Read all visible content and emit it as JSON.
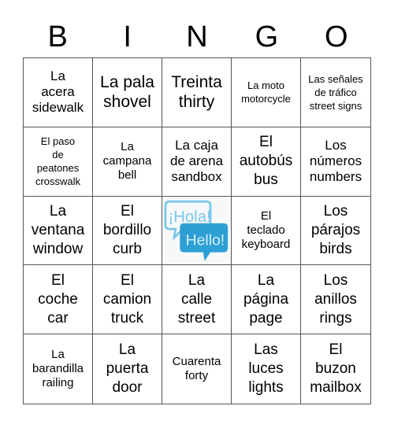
{
  "header": {
    "letters": [
      "B",
      "I",
      "N",
      "G",
      "O"
    ]
  },
  "free_space": {
    "icon": "hola-hello-speech-bubbles-icon",
    "text_es": "¡Hola!",
    "text_en": "Hello!",
    "colors": {
      "light_bubble": "#7cc8ea",
      "dark_bubble": "#2d9fd4"
    }
  },
  "cells": [
    {
      "es": "La\nacera",
      "en": "sidewalk",
      "size": "s-m"
    },
    {
      "es": "La pala",
      "en": "shovel",
      "size": "s-xl"
    },
    {
      "es": "Treinta",
      "en": "thirty",
      "size": "s-xl"
    },
    {
      "es": "La moto",
      "en": "motorcycle",
      "size": "s-xs"
    },
    {
      "es": "Las señales\nde tráfico",
      "en": "street signs",
      "size": "s-xs"
    },
    {
      "es": "El paso\nde\npeatones",
      "en": "crosswalk",
      "size": "s-xs"
    },
    {
      "es": "La\ncampana",
      "en": "bell",
      "size": "s-s"
    },
    {
      "es": "La caja\nde arena",
      "en": "sandbox",
      "size": "s-m"
    },
    {
      "es": "El\nautobús",
      "en": "bus",
      "size": "s-l"
    },
    {
      "es": "Los\nnúmeros",
      "en": "numbers",
      "size": "s-m"
    },
    {
      "es": "La\nventana",
      "en": "window",
      "size": "s-l"
    },
    {
      "es": "El\nbordillo",
      "en": "curb",
      "size": "s-l"
    },
    {
      "free": true
    },
    {
      "es": "El\nteclado",
      "en": "keyboard",
      "size": "s-s"
    },
    {
      "es": "Los\npárajos",
      "en": "birds",
      "size": "s-l"
    },
    {
      "es": "El\ncoche",
      "en": "car",
      "size": "s-l"
    },
    {
      "es": "El\ncamion",
      "en": "truck",
      "size": "s-l"
    },
    {
      "es": "La\ncalle",
      "en": "street",
      "size": "s-l"
    },
    {
      "es": "La\npágina",
      "en": "page",
      "size": "s-l"
    },
    {
      "es": "Los\nanillos",
      "en": "rings",
      "size": "s-l"
    },
    {
      "es": "La\nbarandilla",
      "en": "railing",
      "size": "s-s"
    },
    {
      "es": "La\npuerta",
      "en": "door",
      "size": "s-l"
    },
    {
      "es": "Cuarenta",
      "en": "forty",
      "size": "s-s"
    },
    {
      "es": "Las\nluces",
      "en": "lights",
      "size": "s-l"
    },
    {
      "es": "El\nbuzon",
      "en": "mailbox",
      "size": "s-l"
    }
  ]
}
